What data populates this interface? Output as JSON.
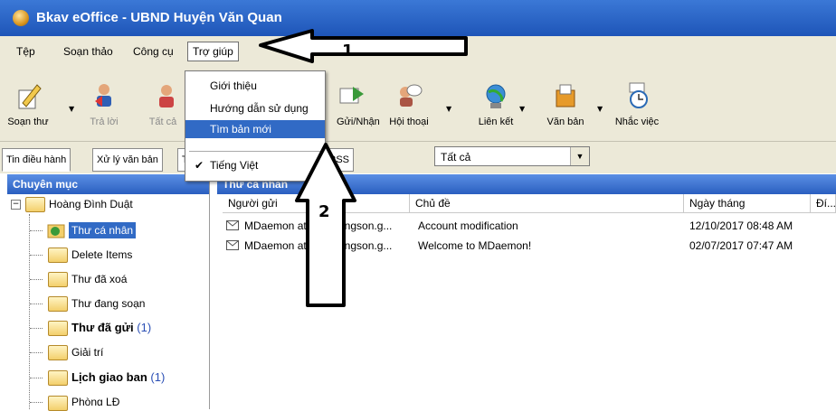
{
  "window": {
    "title": "Bkav eOffice - UBND Huyện Văn Quan"
  },
  "menubar": {
    "items": [
      {
        "label": "Tệp"
      },
      {
        "label": "Soạn thảo"
      },
      {
        "label": "Công cụ"
      },
      {
        "label": "Trợ giúp",
        "active": true
      }
    ]
  },
  "help_menu": {
    "items": [
      {
        "label": "Giới thiệu"
      },
      {
        "label": "Hướng dẫn sử dụng"
      },
      {
        "label": "Tìm bản mới",
        "highlighted": true
      },
      {
        "label": "Tiếng Việt",
        "checked": true,
        "check": "✔"
      }
    ]
  },
  "toolbar": {
    "buttons": [
      {
        "label": "Soạn thư",
        "icon": "compose-icon"
      },
      {
        "label": "Trả lời",
        "icon": "reply-icon",
        "disabled": true
      },
      {
        "label": "Tất cả",
        "icon": "reply-all-icon",
        "disabled": true
      },
      {
        "label": "Gửi/Nhận",
        "icon": "send-receive-icon"
      },
      {
        "label": "Hội thoại",
        "icon": "conversation-icon"
      },
      {
        "label": "Liên kết",
        "icon": "link-icon"
      },
      {
        "label": "Văn bản",
        "icon": "document-icon"
      },
      {
        "label": "Nhắc việc",
        "icon": "reminder-icon"
      }
    ]
  },
  "tabs": {
    "items": [
      {
        "label": "Tin điều hành"
      },
      {
        "label": "Xử lý văn bản"
      },
      {
        "label": "Tin tức"
      },
      {
        "label": "Đọc tin vắn tắt RSS"
      }
    ],
    "filter_value": "Tất cả"
  },
  "sidebar": {
    "header": "Chuyên mục",
    "root": "Hoàng Đình Duật",
    "items": [
      {
        "label": "Thư cá nhân",
        "selected": true
      },
      {
        "label": "Delete Items"
      },
      {
        "label": "Thư đã xoá"
      },
      {
        "label": "Thư đang soạn"
      },
      {
        "label": "Thư đã gửi",
        "bold": true,
        "count": "(1)"
      },
      {
        "label": "Giải trí"
      },
      {
        "label": "Lịch giao ban",
        "bold": true,
        "count": "(1)"
      },
      {
        "label": "Phòng LĐ"
      }
    ]
  },
  "mail": {
    "header": "Thư cá nhân",
    "columns": [
      "Người gửi",
      "Chủ đề",
      "Ngày tháng",
      "Đí..."
    ],
    "rows": [
      {
        "sender": "MDaemon at",
        "sender_tail": "angson.g...",
        "subject": "Account modification",
        "date": "12/10/2017 08:48 AM"
      },
      {
        "sender": "MDaemon at",
        "sender_tail": "angson.g...",
        "subject": "Welcome to MDaemon!",
        "date": "02/07/2017 07:47 AM"
      }
    ]
  },
  "annotations": {
    "arrow1": "1",
    "arrow2": "2"
  }
}
